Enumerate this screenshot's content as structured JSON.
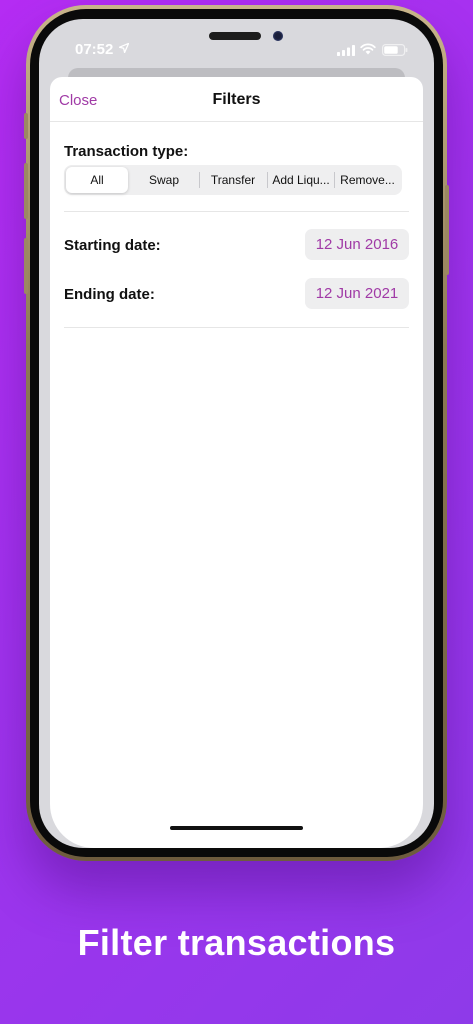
{
  "status_bar": {
    "time": "07:52",
    "icons": [
      "location-arrow-icon",
      "cellular-signal-icon",
      "wifi-icon",
      "battery-icon"
    ]
  },
  "sheet": {
    "close_label": "Close",
    "title": "Filters",
    "transaction_type": {
      "label": "Transaction type:",
      "options": [
        "All",
        "Swap",
        "Transfer",
        "Add Liqu...",
        "Remove..."
      ],
      "selected": "All"
    },
    "starting_date": {
      "label": "Starting date:",
      "value": "12 Jun 2016"
    },
    "ending_date": {
      "label": "Ending date:",
      "value": "12 Jun 2021"
    }
  },
  "caption": "Filter transactions",
  "colors": {
    "accent": "#a03aa6",
    "background_start": "#b52cf3",
    "background_end": "#8e3ae9"
  }
}
